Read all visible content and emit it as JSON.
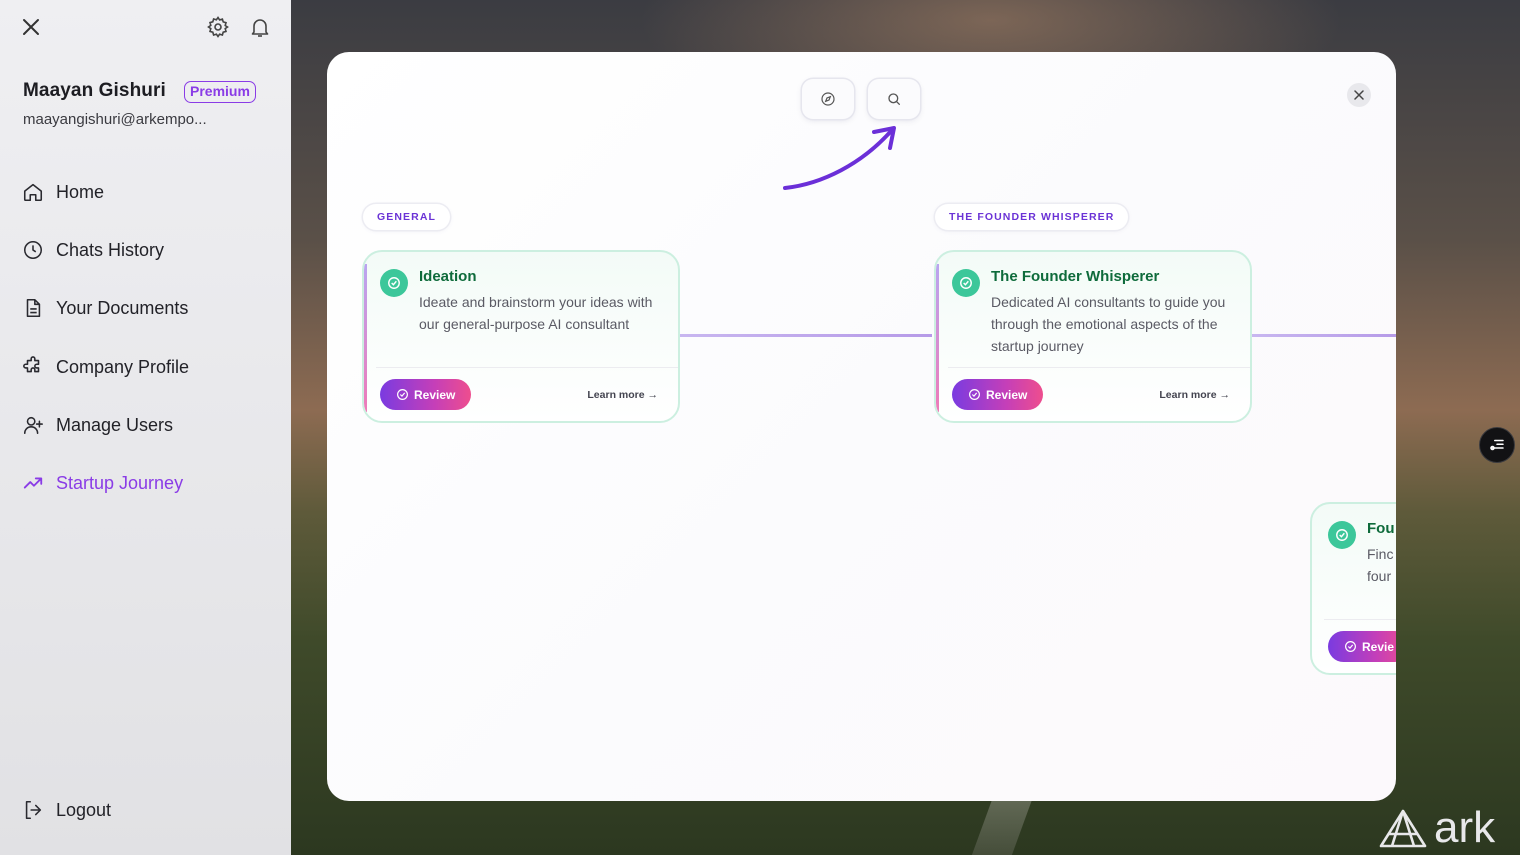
{
  "sidebar": {
    "user_name": "Maayan Gishuri",
    "badge": "Premium",
    "email": "maayangishuri@arkempo...",
    "nav": [
      {
        "label": "Home",
        "icon": "home-icon"
      },
      {
        "label": "Chats History",
        "icon": "clock-icon"
      },
      {
        "label": "Your Documents",
        "icon": "document-icon"
      },
      {
        "label": "Company Profile",
        "icon": "puzzle-icon"
      },
      {
        "label": "Manage Users",
        "icon": "user-plus-icon"
      },
      {
        "label": "Startup Journey",
        "icon": "trending-up-icon",
        "active": true
      }
    ],
    "logout": "Logout"
  },
  "modal": {
    "top_buttons": [
      "compass-icon",
      "search-icon"
    ],
    "sections": [
      "GENERAL",
      "THE FOUNDER WHISPERER"
    ],
    "cards": [
      {
        "title": "Ideation",
        "description": "Ideate and brainstorm your ideas with our general-purpose AI consultant",
        "review_label": "Review",
        "learn_more": "Learn more →"
      },
      {
        "title": "The Founder Whisperer",
        "description": "Dedicated AI consultants to guide you through the emotional aspects of the startup journey",
        "review_label": "Review",
        "learn_more": "Learn more →"
      },
      {
        "title": "Fou",
        "description_lines": [
          "Finc",
          "four"
        ],
        "review_label": "Revie"
      }
    ]
  },
  "brand": {
    "name": "ark"
  },
  "colors": {
    "accent": "#8a3ce6",
    "check": "#3cc79a",
    "title_green": "#0e6b3b"
  }
}
